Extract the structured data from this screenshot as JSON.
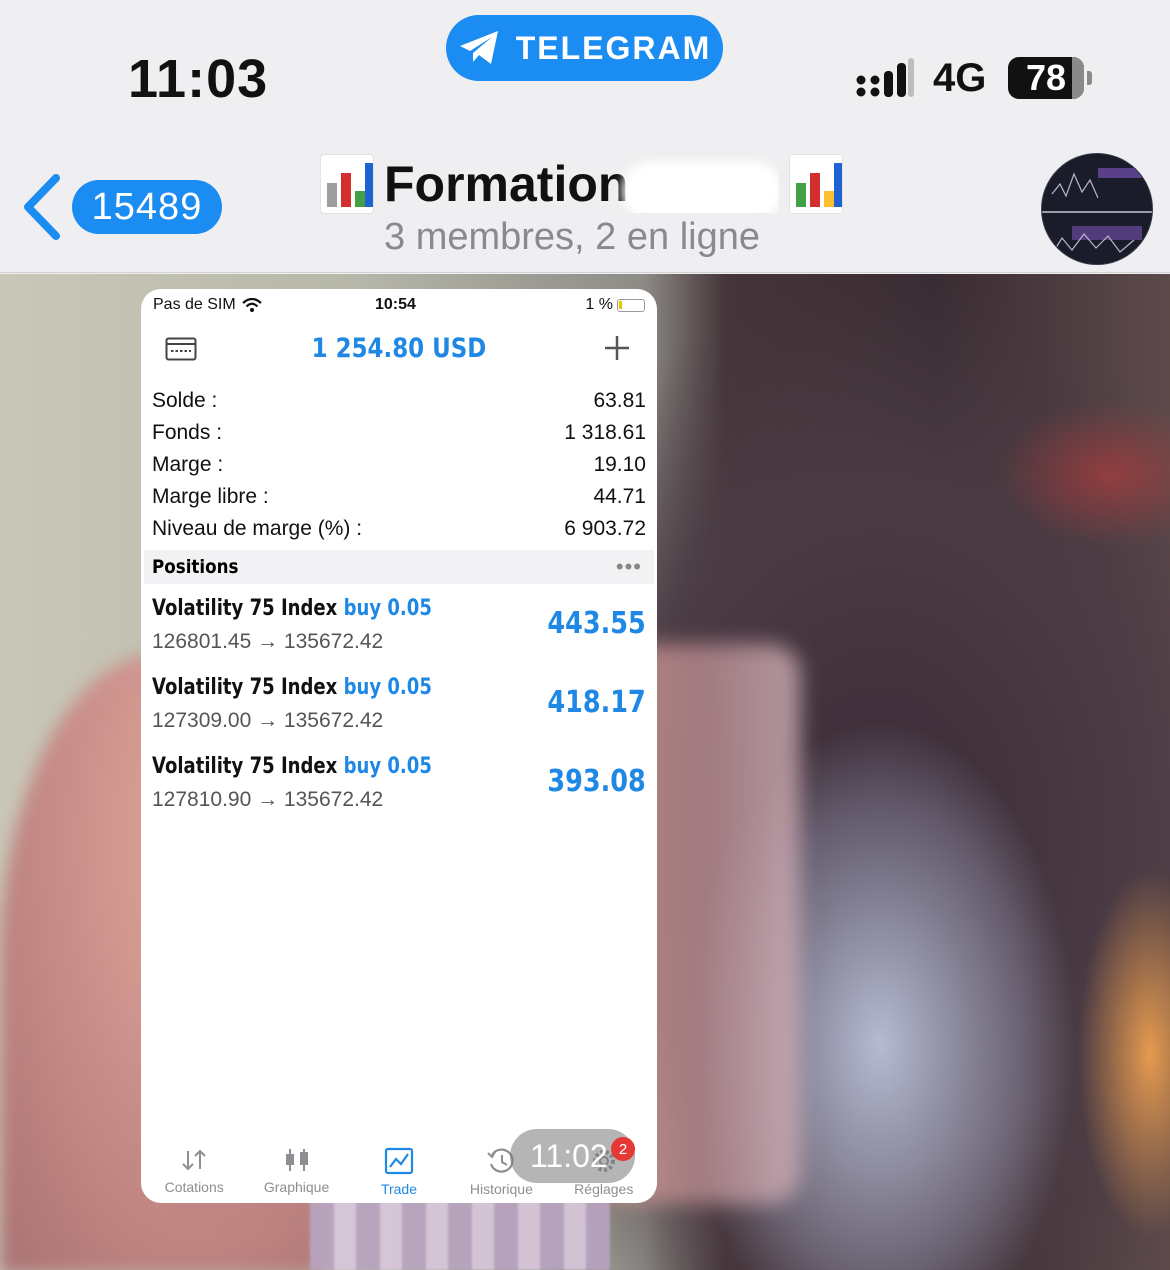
{
  "status_bar": {
    "time": "11:03",
    "return_app": "TELEGRAM",
    "network": "4G",
    "battery": "78"
  },
  "chat": {
    "unread_count": "15489",
    "title": "Formation",
    "subtitle": "3 membres, 2 en ligne"
  },
  "mt_screenshot": {
    "status": {
      "carrier": "Pas de SIM",
      "time": "10:54",
      "battery": "1 %"
    },
    "header": {
      "amount": "1 254.80 USD"
    },
    "summary": [
      {
        "label": "Solde :",
        "value": "63.81"
      },
      {
        "label": "Fonds :",
        "value": "1 318.61"
      },
      {
        "label": "Marge :",
        "value": "19.10"
      },
      {
        "label": "Marge libre :",
        "value": "44.71"
      },
      {
        "label": "Niveau de marge (%) :",
        "value": "6 903.72"
      }
    ],
    "positions_label": "Positions",
    "more_label": "•••",
    "positions": [
      {
        "symbol": "Volatility 75 Index",
        "side": "buy 0.05",
        "prices": "126801.45 → 135672.42",
        "profit": "443.55"
      },
      {
        "symbol": "Volatility 75 Index",
        "side": "buy 0.05",
        "prices": "127309.00 → 135672.42",
        "profit": "418.17"
      },
      {
        "symbol": "Volatility 75 Index",
        "side": "buy 0.05",
        "prices": "127810.90 → 135672.42",
        "profit": "393.08"
      }
    ],
    "tabs": [
      {
        "label": "Cotations",
        "icon": "quotes-icon"
      },
      {
        "label": "Graphique",
        "icon": "chart-icon"
      },
      {
        "label": "Trade",
        "icon": "trade-icon",
        "active": true
      },
      {
        "label": "Historique",
        "icon": "history-icon"
      },
      {
        "label": "Réglages",
        "icon": "settings-icon"
      }
    ]
  },
  "message": {
    "time": "11:02",
    "badge": "2"
  },
  "colors": {
    "telegram_blue": "#1a8cf2",
    "mt_blue": "#1f88e5"
  }
}
